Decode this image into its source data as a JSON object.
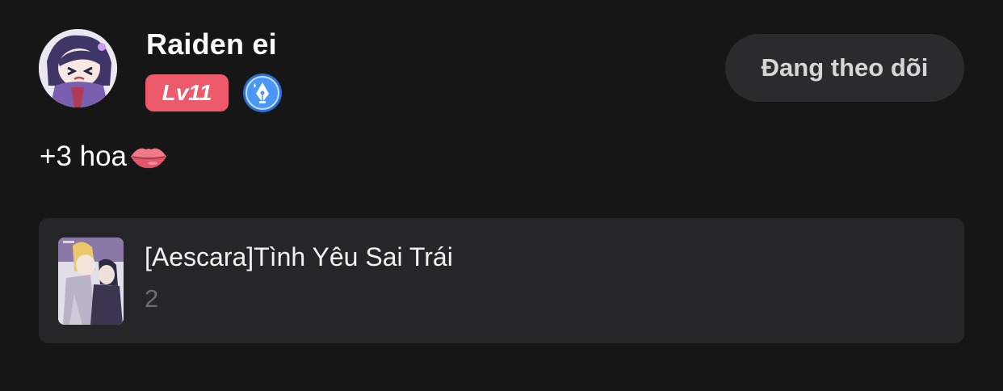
{
  "user": {
    "name": "Raiden ei",
    "level_label": "Lv11",
    "avatar_icon": "avatar-image",
    "writer_badge_icon": "pen-nib-badge-icon"
  },
  "follow_button": {
    "label": "Đang theo dõi"
  },
  "comment": {
    "text": "+3 hoa",
    "emoji_icon": "lips-icon"
  },
  "story": {
    "title": "[Aescara]Tình Yêu Sai Trái",
    "subtitle": "2",
    "cover_icon": "story-cover-image"
  },
  "colors": {
    "background": "#161617",
    "level_badge": "#ec5a6c",
    "writer_badge": "#3d8bf0",
    "button_bg": "#2b2b2d",
    "card_bg": "#262628"
  }
}
